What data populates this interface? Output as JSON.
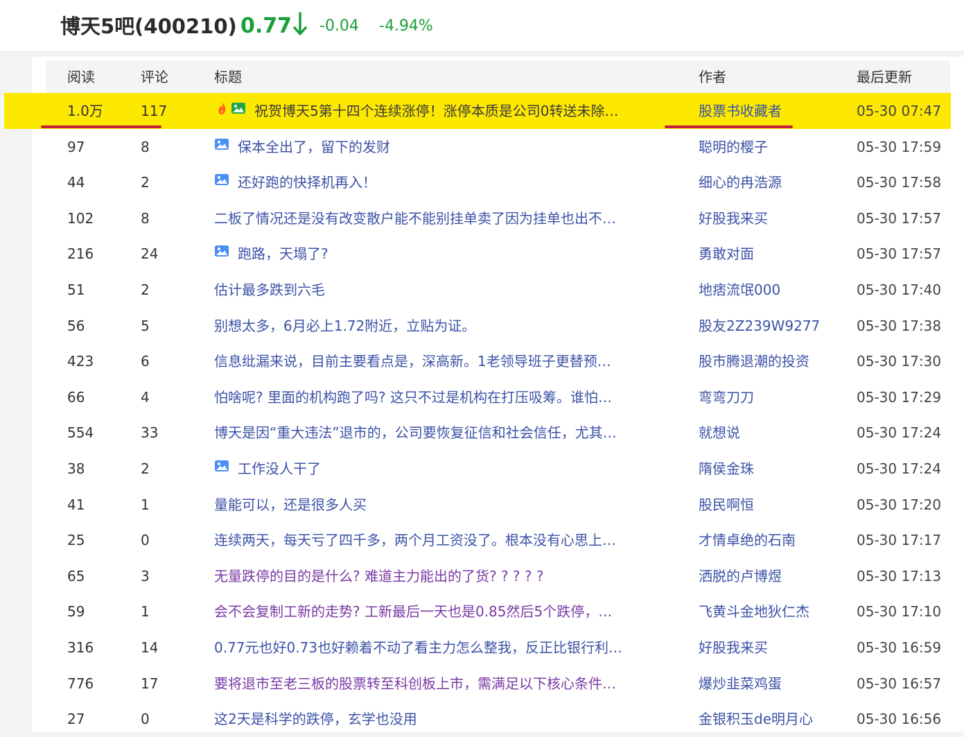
{
  "header": {
    "name": "博天5吧(400210)",
    "price": "0.77",
    "change": "-0.04",
    "change_pct": "-4.94%",
    "trend": "down",
    "price_color": "#1a9e3a"
  },
  "columns": {
    "read": "阅读",
    "comments": "评论",
    "title": "标题",
    "author": "作者",
    "updated": "最后更新"
  },
  "colors": {
    "highlight": "#fde800",
    "title_link": "#3c52a6",
    "title_visited": "#7a3aa5",
    "underline": "#c21f3a"
  },
  "posts": [
    {
      "read": "1.0万",
      "comments": "117",
      "title": "祝贺博天5第十四个连续涨停！涨停本质是公司0转送未除…",
      "author": "股票书收藏者",
      "updated": "05-30 07:47",
      "icons": [
        "fire-icon",
        "image-icon"
      ],
      "highlighted": true,
      "title_color": "#3c52a6"
    },
    {
      "read": "97",
      "comments": "8",
      "title": "保本全出了，留下的发财",
      "author": "聪明的樱子",
      "updated": "05-30 17:59",
      "icons": [
        "image-icon"
      ],
      "title_color": "#3c52a6"
    },
    {
      "read": "44",
      "comments": "2",
      "title": "还好跑的快择机再入！",
      "author": "细心的冉浩源",
      "updated": "05-30 17:58",
      "icons": [
        "image-icon"
      ],
      "title_color": "#3c52a6"
    },
    {
      "read": "102",
      "comments": "8",
      "title": "二板了情况还是没有改变散户能不能别挂单卖了因为挂单也出不…",
      "author": "好股我来买",
      "updated": "05-30 17:57",
      "icons": [],
      "title_color": "#3c52a6"
    },
    {
      "read": "216",
      "comments": "24",
      "title": "跑路，天塌了?",
      "author": "勇敢对面",
      "updated": "05-30 17:57",
      "icons": [
        "image-icon"
      ],
      "title_color": "#3c52a6"
    },
    {
      "read": "51",
      "comments": "2",
      "title": "估计最多跌到六毛",
      "author": "地痞流氓000",
      "updated": "05-30 17:40",
      "icons": [],
      "title_color": "#3c52a6"
    },
    {
      "read": "56",
      "comments": "5",
      "title": "别想太多，6月必上1.72附近，立贴为证。",
      "author": "股友2Z239W9277",
      "updated": "05-30 17:38",
      "icons": [],
      "title_color": "#3c52a6"
    },
    {
      "read": "423",
      "comments": "6",
      "title": "信息纰漏来说，目前主要看点是，深高新。1老领导班子更替预…",
      "author": "股市腾退潮的投资",
      "updated": "05-30 17:30",
      "icons": [],
      "title_color": "#3c52a6"
    },
    {
      "read": "66",
      "comments": "4",
      "title": "怕啥呢? 里面的机构跑了吗? 这只不过是机构在打压吸筹。谁怕…",
      "author": "弯弯刀刀",
      "updated": "05-30 17:29",
      "icons": [],
      "title_color": "#3c52a6"
    },
    {
      "read": "554",
      "comments": "33",
      "title": "博天是因“重大违法”退市的，公司要恢复征信和社会信任，尤其…",
      "author": "就想说",
      "updated": "05-30 17:24",
      "icons": [],
      "title_color": "#3c52a6"
    },
    {
      "read": "38",
      "comments": "2",
      "title": "工作没人干了",
      "author": "隋侯金珠",
      "updated": "05-30 17:24",
      "icons": [
        "image-icon"
      ],
      "title_color": "#3c52a6"
    },
    {
      "read": "41",
      "comments": "1",
      "title": "量能可以，还是很多人买",
      "author": "股民啊恒",
      "updated": "05-30 17:20",
      "icons": [],
      "title_color": "#3c52a6"
    },
    {
      "read": "25",
      "comments": "0",
      "title": "连续两天，每天亏了四千多，两个月工资没了。根本没有心思上…",
      "author": "才情卓绝的石南",
      "updated": "05-30 17:17",
      "icons": [],
      "title_color": "#3c52a6"
    },
    {
      "read": "65",
      "comments": "3",
      "title": "无量跌停的目的是什么? 难道主力能出的了货? ? ? ? ?",
      "author": "洒脱的卢博煜",
      "updated": "05-30 17:13",
      "icons": [],
      "title_color": "#7a3aa5"
    },
    {
      "read": "59",
      "comments": "1",
      "title": "会不会复制工新的走势? 工新最后一天也是0.85然后5个跌停，…",
      "author": "飞黄斗金地狄仁杰",
      "updated": "05-30 17:10",
      "icons": [],
      "title_color": "#7a3aa5"
    },
    {
      "read": "316",
      "comments": "14",
      "title": "0.77元也好0.73也好赖着不动了看主力怎么整我，反正比银行利…",
      "author": "好股我来买",
      "updated": "05-30 16:59",
      "icons": [],
      "title_color": "#3c52a6"
    },
    {
      "read": "776",
      "comments": "17",
      "title": "要将退市至老三板的股票转至科创板上市，需满足以下核心条件…",
      "author": "爆炒韭菜鸡蛋",
      "updated": "05-30 16:57",
      "icons": [],
      "title_color": "#7a3aa5"
    },
    {
      "read": "27",
      "comments": "0",
      "title": "这2天是科学的跌停，玄学也没用",
      "author": "金银积玉de明月心",
      "updated": "05-30 16:56",
      "icons": [],
      "title_color": "#3c52a6"
    }
  ]
}
